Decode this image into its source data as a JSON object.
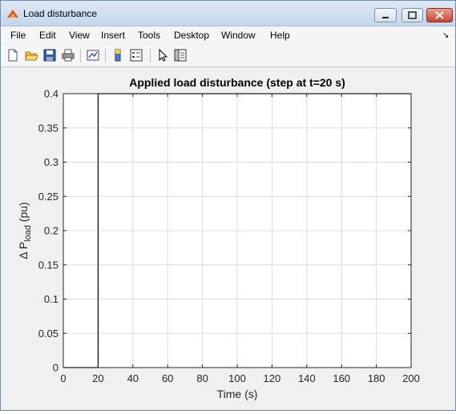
{
  "window": {
    "title": "Load disturbance"
  },
  "menu": {
    "items": [
      "File",
      "Edit",
      "View",
      "Insert",
      "Tools",
      "Desktop",
      "Window",
      "Help"
    ]
  },
  "toolbar": {
    "icons": [
      "new-file-icon",
      "open-folder-icon",
      "save-icon",
      "print-icon",
      "link-plot-icon",
      "insert-colorbar-icon",
      "insert-legend-icon",
      "pointer-icon",
      "property-inspector-icon"
    ]
  },
  "colors": {
    "line": "#000000",
    "grid": "#dcdcdc",
    "figure_bg": "#f0f0f0",
    "axes_bg": "#ffffff"
  },
  "chart_data": {
    "type": "line",
    "title": "Applied load disturbance (step at t=20 s)",
    "xlabel": "Time (s)",
    "ylabel": {
      "main": "Δ P",
      "subscript": "load",
      "suffix": " (pu)"
    },
    "xlim": [
      0,
      200
    ],
    "ylim": [
      0,
      0.4
    ],
    "xticks": [
      0,
      20,
      40,
      60,
      80,
      100,
      120,
      140,
      160,
      180,
      200
    ],
    "yticks": [
      0,
      0.05,
      0.1,
      0.15,
      0.2,
      0.25,
      0.3,
      0.35,
      0.4
    ],
    "ytick_labels": [
      "0",
      "0.05",
      "0.1",
      "0.15",
      "0.2",
      "0.25",
      "0.3",
      "0.35",
      "0.4"
    ],
    "grid": true,
    "series": [
      {
        "x": [
          0,
          20,
          20,
          200
        ],
        "y": [
          0,
          0,
          0.4,
          0.4
        ]
      }
    ]
  }
}
